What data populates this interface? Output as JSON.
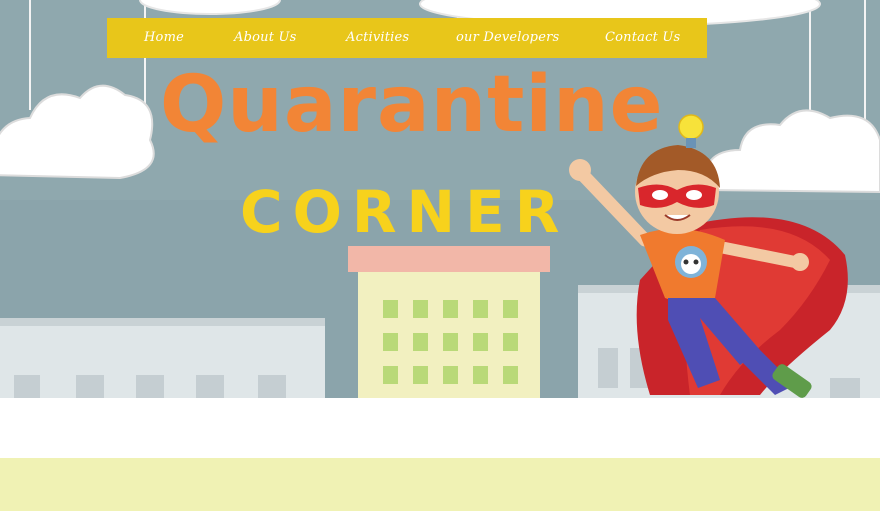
{
  "nav": {
    "items": [
      {
        "label": "Home"
      },
      {
        "label": "About Us"
      },
      {
        "label": "Activities"
      },
      {
        "label": "our Developers"
      },
      {
        "label": "Contact Us"
      }
    ]
  },
  "hero": {
    "title_line1": "Quarantine",
    "title_line2": "CORNER"
  },
  "colors": {
    "nav_bg": "#e8c61a",
    "title_orange": "#f28536",
    "title_yellow": "#f7d21c",
    "sky": "#8ea6ad",
    "band": "#f0f2b4"
  }
}
